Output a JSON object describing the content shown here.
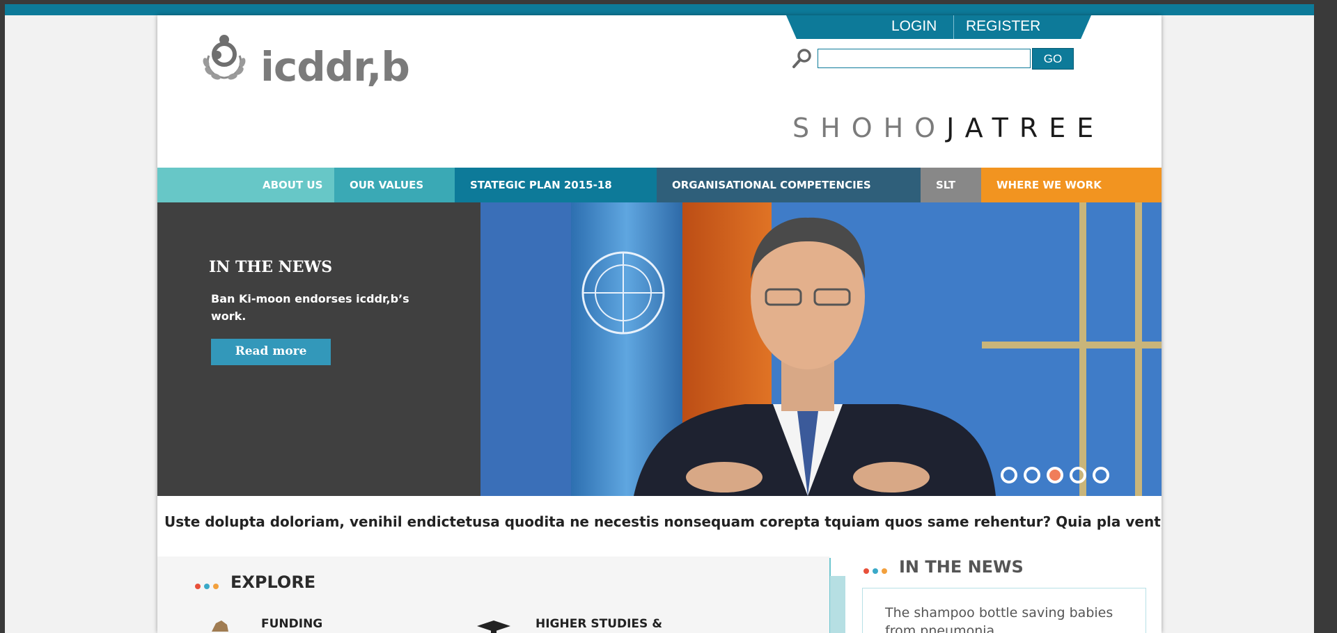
{
  "auth": {
    "login": "LOGIN",
    "register": "REGISTER"
  },
  "brand": {
    "name": "icddr,b"
  },
  "search": {
    "placeholder": "",
    "button": "GO"
  },
  "tagline": {
    "part1": "SHOHO",
    "part2": "JATREE"
  },
  "nav": {
    "items": [
      {
        "label": "ABOUT US",
        "color": "#67c7c7"
      },
      {
        "label": "OUR VALUES",
        "color": "#3aa9b5"
      },
      {
        "label": "STATEGIC PLAN 2015-18",
        "color": "#0d7a99"
      },
      {
        "label": "ORGANISATIONAL COMPETENCIES",
        "color": "#2f5f7a"
      },
      {
        "label": "SLT",
        "color": "#888888"
      },
      {
        "label": "WHERE WE WORK",
        "color": "#f29420"
      }
    ]
  },
  "hero": {
    "title": "IN THE NEWS",
    "text": "Ban Ki-moon endorses icddr,b’s work.",
    "button": "Read more",
    "slides_count": 5,
    "active_slide": 3
  },
  "marquee": {
    "text": "Uste dolupta doloriam, venihil endictetusa quodita ne necestis nonsequam corepta tquiam quos same rehentur? Quia pla vent, Bis et"
  },
  "explore": {
    "title": "EXPLORE",
    "items": [
      {
        "label": "FUNDING"
      },
      {
        "label": "HIGHER STUDIES &"
      }
    ]
  },
  "news_sidebar": {
    "title": "IN THE NEWS",
    "first_item": "The shampoo bottle saving babies from pneumonia"
  },
  "colors": {
    "brand": "#0d7a99",
    "accent_orange": "#f29420",
    "dot_red": "#e8503a",
    "dot_blue": "#3aa9c8",
    "dot_orange": "#f2a03d"
  }
}
